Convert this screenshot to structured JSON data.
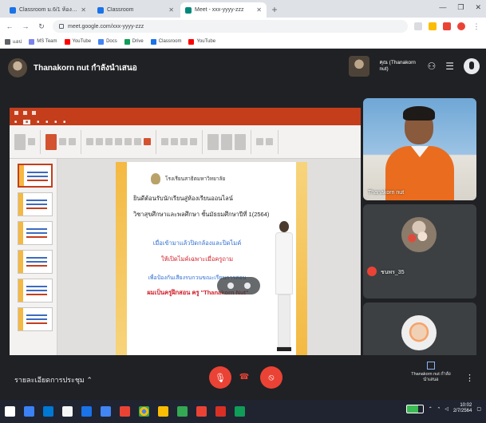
{
  "browser": {
    "tabs": [
      {
        "title": "Classroom ม.6/1 ห้อง ...",
        "color": "#1a73e8",
        "active": false
      },
      {
        "title": "Classroom",
        "color": "#1a73e8",
        "active": false
      },
      {
        "title": "Meet - xxx-yyyy-zzz",
        "color": "#00897b",
        "active": true
      }
    ],
    "address": "meet.google.com/xxx-yyyy-zzz",
    "bookmarks": [
      {
        "label": "แอป",
        "color": "#5f6368"
      },
      {
        "label": "MS Team",
        "color": "#7b83eb"
      },
      {
        "label": "YouTube",
        "color": "#ff0000"
      },
      {
        "label": "Docs",
        "color": "#4285f4"
      },
      {
        "label": "Drive",
        "color": "#0f9d58"
      },
      {
        "label": "Classroom",
        "color": "#1a73e8"
      },
      {
        "label": "YouTube",
        "color": "#ff0000"
      }
    ]
  },
  "meet": {
    "presenter_label": "Thanakorn nut กำลังนำเสนอ",
    "self_label": "คุณ (Thanakorn nut)",
    "presentation": {
      "slide": {
        "school": "โรงเรียนสาธิตมหาวิทยาลัย",
        "line1": "ยินดีต้อนรับนักเรียนสู่ห้องเรียนออนไลน์",
        "line2": "วิชาสุขศึกษาและพลศึกษา ชั้นมัธยมศึกษาปีที่ 1(2564)",
        "blue1": "เมื่อเข้ามาแล้วปิดกล้องและปิดไมค์",
        "red1": "ให้เปิดไมค์เฉพาะเมื่อครูถาม",
        "blue2": "เพื่อป้องกันเสียงรบกวนขณะเรียนการสอน",
        "red2": "ผมเป็นครูฝึกสอน ครู \"Thanakorn Nut\""
      }
    },
    "participants": [
      {
        "name": "Thanakorn nut",
        "type": "video"
      },
      {
        "name": "ชนพร_35",
        "type": "avatar",
        "muted": true
      },
      {
        "name": "",
        "type": "avatar",
        "muted": false
      }
    ],
    "controls": {
      "meeting_name": "รายละเอียดการประชุม",
      "present_label": "Thanakorn nut กำลังนำเสนอ"
    }
  },
  "taskbar": {
    "time": "10:02",
    "date": "2/7/2564",
    "apps": [
      "#3ddc84",
      "#4285f4",
      "#0078d4",
      "#f5f5f5",
      "#1a73e8",
      "#ea4335",
      "#4285f4",
      "#fbbc04",
      "#ea4335",
      "#34a853",
      "#4285f4",
      "#d93025",
      "#0f9d58"
    ]
  }
}
